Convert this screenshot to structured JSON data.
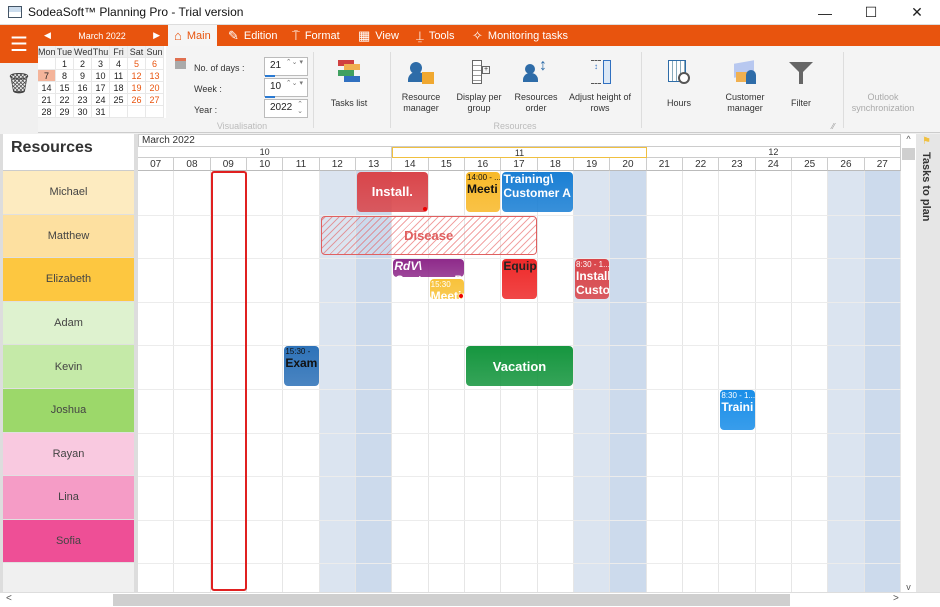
{
  "window": {
    "title": "SodeaSoft™ Planning Pro - Trial version",
    "controls": {
      "minimize": "—",
      "maximize": "☐",
      "close": "✕"
    }
  },
  "menu_icon": "☰",
  "tabs": [
    {
      "label": "Main",
      "icon": "home-icon",
      "glyph": "⌂",
      "active": true
    },
    {
      "label": "Edition",
      "icon": "edit-icon",
      "glyph": "✎",
      "active": false
    },
    {
      "label": "Format",
      "icon": "paint-roller-icon",
      "glyph": "⍑",
      "active": false
    },
    {
      "label": "View",
      "icon": "view-grid-icon",
      "glyph": "▦",
      "active": false
    },
    {
      "label": "Tools",
      "icon": "tools-icon",
      "glyph": "⍊",
      "active": false
    },
    {
      "label": "Monitoring tasks",
      "icon": "pin-icon",
      "glyph": "✧",
      "active": false
    }
  ],
  "mini_calendar": {
    "title": "March 2022",
    "prev": "◀",
    "next": "▶",
    "dow": [
      "Mon",
      "Tue",
      "Wed",
      "Thu",
      "Fri",
      "Sat",
      "Sun"
    ],
    "weeks": [
      [
        "",
        "1",
        "2",
        "3",
        "4",
        "5",
        "6"
      ],
      [
        "7",
        "8",
        "9",
        "10",
        "11",
        "12",
        "13"
      ],
      [
        "14",
        "15",
        "16",
        "17",
        "18",
        "19",
        "20"
      ],
      [
        "21",
        "22",
        "23",
        "24",
        "25",
        "26",
        "27"
      ],
      [
        "28",
        "29",
        "30",
        "31",
        "",
        "",
        ""
      ]
    ],
    "today": "7"
  },
  "trash_icon": "🗑",
  "visualisation": {
    "group_label": "Visualisation",
    "days_label": "No. of days :",
    "days_value": "21",
    "week_label": "Week :",
    "week_value": "10",
    "year_label": "Year :",
    "year_value": "2022"
  },
  "ribbon_buttons": {
    "tasks_list": "Tasks list",
    "resource_manager": "Resource manager",
    "display_per_group": "Display per group",
    "resources_order": "Resources order",
    "adjust_height": "Adjust height of rows",
    "resources_group": "Resources",
    "hours": "Hours",
    "customer_manager": "Customer manager",
    "filter": "Filter",
    "outlook_sync": "Outlook synchronization"
  },
  "gantt": {
    "resources_header": "Resources",
    "month": "March 2022",
    "weeks": [
      {
        "label": "10",
        "days": 7
      },
      {
        "label": "11",
        "days": 7
      },
      {
        "label": "12",
        "days": 7
      }
    ],
    "current_week": "11",
    "days": [
      "07",
      "08",
      "09",
      "10",
      "11",
      "12",
      "13",
      "14",
      "15",
      "16",
      "17",
      "18",
      "19",
      "20",
      "21",
      "22",
      "23",
      "24",
      "25",
      "26",
      "27"
    ],
    "weekend_sat": [
      "12",
      "19",
      "26"
    ],
    "weekend_sun": [
      "13",
      "20",
      "27"
    ],
    "selected_day": "09",
    "resources": [
      {
        "name": "Michael",
        "color": "#fdebc0"
      },
      {
        "name": "Matthew",
        "color": "#fde0a0"
      },
      {
        "name": "Elizabeth",
        "color": "#fdc740"
      },
      {
        "name": "Adam",
        "color": "#def2cf"
      },
      {
        "name": "Kevin",
        "color": "#c5eaa8"
      },
      {
        "name": "Joshua",
        "color": "#9cd86a"
      },
      {
        "name": "Rayan",
        "color": "#f9c9e0"
      },
      {
        "name": "Lina",
        "color": "#f59cc6"
      },
      {
        "name": "Sofia",
        "color": "#ee4f96"
      }
    ],
    "tasks": [
      {
        "name": "Install.",
        "time": "",
        "row": 0,
        "start": 6,
        "span": 2,
        "color": "#d9454a",
        "style": "center",
        "alert": true
      },
      {
        "name": "Meeti",
        "time": "14:00 - ...",
        "row": 0,
        "start": 9,
        "span": 1,
        "color": "#f8b92a",
        "text": "#111",
        "alert": false
      },
      {
        "name": "Training\\ Customer A",
        "time": "",
        "row": 0,
        "start": 10,
        "span": 2,
        "color": "#1a7fd4",
        "alert": false
      },
      {
        "name": "Disease",
        "time": "",
        "row": 1,
        "start": 5,
        "span": 6,
        "style": "hatch",
        "alert": false
      },
      {
        "name": "RdV\\ Customer B",
        "time": "",
        "row": 2,
        "start": 7,
        "span": 2,
        "color": "#8e2a8a",
        "italic": true,
        "half": "top",
        "alert": false
      },
      {
        "name": "Meetin",
        "time": "15:30",
        "row": 2,
        "start": 8,
        "span": 1,
        "color": "#f8c23a",
        "half": "bottom",
        "alert": true
      },
      {
        "name": "Equip",
        "time": "",
        "row": 2,
        "start": 10,
        "span": 1,
        "color": "#ee2a2a",
        "text": "#222",
        "alert": false
      },
      {
        "name": "Install. Customer",
        "time": "8:30 - 1...",
        "row": 2,
        "start": 12,
        "span": 1,
        "color": "#d9454a",
        "alert": false
      },
      {
        "name": "Exam",
        "time": "15:30 -",
        "row": 4,
        "start": 4,
        "span": 1,
        "color": "#2e72b8",
        "text": "#111",
        "alert": false
      },
      {
        "name": "Vacation",
        "time": "",
        "row": 4,
        "start": 9,
        "span": 3,
        "color": "#16963f",
        "style": "center",
        "alert": false
      },
      {
        "name": "Traini",
        "time": "8:30 - 1...",
        "row": 5,
        "start": 16,
        "span": 1,
        "color": "#1a8ee8",
        "alert": false
      }
    ]
  },
  "side_panel": {
    "label": "Tasks to plan",
    "icon": "flag-icon"
  },
  "scroll": {
    "up": "^",
    "down": "v",
    "left": "<",
    "right": ">"
  }
}
